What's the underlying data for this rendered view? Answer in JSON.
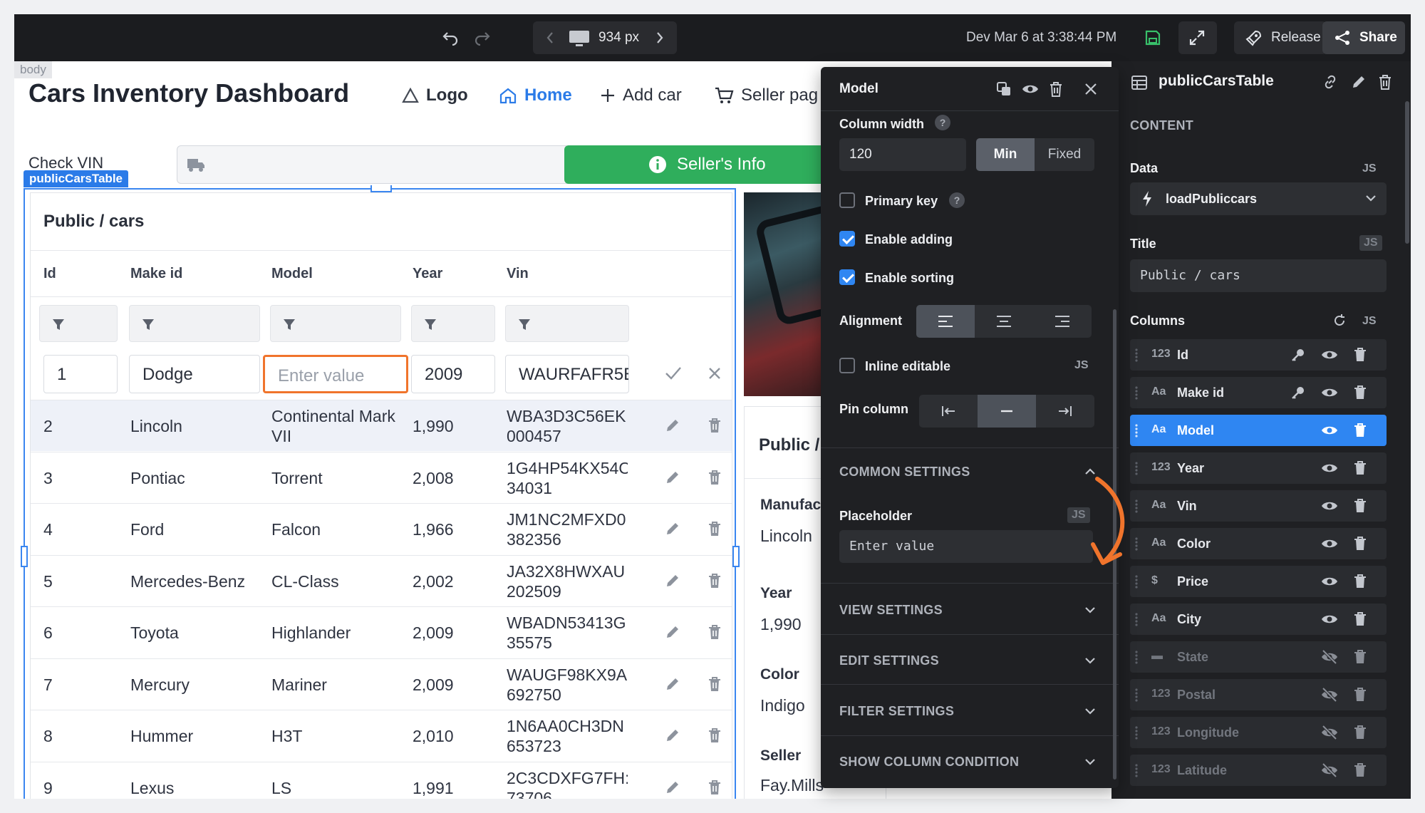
{
  "topbar": {
    "viewport": "934 px",
    "env_status": "Dev Mar 6 at 3:38:44 PM",
    "release_label": "Release",
    "share_label": "Share"
  },
  "canvas": {
    "body_tag": "body",
    "app_title": "Cars Inventory Dashboard",
    "nav": {
      "logo": "Logo",
      "home": "Home",
      "add_car": "Add car",
      "seller": "Seller pag"
    },
    "check_vin_label": "Check VIN",
    "sellers_button": "Seller's Info",
    "table_tag": "publicCarsTable"
  },
  "table": {
    "title": "Public / cars",
    "columns": [
      "Id",
      "Make id",
      "Model",
      "Year",
      "Vin"
    ],
    "edit_row": {
      "id": "1",
      "make": "Dodge",
      "model_placeholder": "Enter value",
      "year": "2009",
      "vin": "WAURFAFR5E"
    },
    "rows": [
      {
        "id": "2",
        "make": "Lincoln",
        "model": "Continental Mark VII",
        "year": "1,990",
        "vin": "WBA3D3C56EK 000457"
      },
      {
        "id": "3",
        "make": "Pontiac",
        "model": "Torrent",
        "year": "2,008",
        "vin": "1G4HP54KX54C 34031"
      },
      {
        "id": "4",
        "make": "Ford",
        "model": "Falcon",
        "year": "1,966",
        "vin": "JM1NC2MFXD0 382356"
      },
      {
        "id": "5",
        "make": "Mercedes-Benz",
        "model": "CL-Class",
        "year": "2,002",
        "vin": "JA32X8HWXAU 202509"
      },
      {
        "id": "6",
        "make": "Toyota",
        "model": "Highlander",
        "year": "2,009",
        "vin": "WBADN53413G 35575"
      },
      {
        "id": "7",
        "make": "Mercury",
        "model": "Mariner",
        "year": "2,009",
        "vin": "WAUGF98KX9A 692750"
      },
      {
        "id": "8",
        "make": "Hummer",
        "model": "H3T",
        "year": "2,010",
        "vin": "1N6AA0CH3DN 653723"
      },
      {
        "id": "9",
        "make": "Lexus",
        "model": "LS",
        "year": "1,991",
        "vin": "2C3CDXFG7FH: 73706"
      }
    ]
  },
  "detail": {
    "title": "Public /",
    "manufacturer_label": "Manufac",
    "manufacturer_value": "Lincoln",
    "year_label": "Year",
    "year_value": "1,990",
    "color_label": "Color",
    "color_value": "Indigo",
    "seller_label": "Seller",
    "seller_value": "Fay.Mills"
  },
  "model_panel": {
    "title": "Model",
    "column_width_label": "Column width",
    "column_width_value": "120",
    "width_mode_min": "Min",
    "width_mode_fixed": "Fixed",
    "primary_key_label": "Primary key",
    "primary_key_checked": false,
    "enable_adding_label": "Enable adding",
    "enable_adding_checked": true,
    "enable_sorting_label": "Enable sorting",
    "enable_sorting_checked": true,
    "alignment_label": "Alignment",
    "alignment_selected": "left",
    "inline_editable_label": "Inline editable",
    "inline_editable_checked": false,
    "pin_column_label": "Pin column",
    "pin_selected": "none",
    "js_label": "JS",
    "common_settings": "COMMON SETTINGS",
    "placeholder_label": "Placeholder",
    "placeholder_value": "Enter value",
    "view_settings": "VIEW SETTINGS",
    "edit_settings": "EDIT SETTINGS",
    "filter_settings": "FILTER SETTINGS",
    "show_column_condition": "SHOW COLUMN CONDITION"
  },
  "inspector": {
    "title": "publicCarsTable",
    "content_section": "CONTENT",
    "data_label": "Data",
    "data_value": "loadPubliccars",
    "title_label": "Title",
    "title_value": "Public / cars",
    "columns_label": "Columns",
    "js_label": "JS",
    "columns": [
      {
        "type": "123",
        "name": "Id",
        "key": true,
        "visible": true,
        "active": false
      },
      {
        "type": "Aa",
        "name": "Make id",
        "key": true,
        "visible": true,
        "active": false
      },
      {
        "type": "Aa",
        "name": "Model",
        "key": false,
        "visible": true,
        "active": true
      },
      {
        "type": "123",
        "name": "Year",
        "key": false,
        "visible": true,
        "active": false
      },
      {
        "type": "Aa",
        "name": "Vin",
        "key": false,
        "visible": true,
        "active": false
      },
      {
        "type": "Aa",
        "name": "Color",
        "key": false,
        "visible": true,
        "active": false
      },
      {
        "type": "$",
        "name": "Price",
        "key": false,
        "visible": true,
        "active": false
      },
      {
        "type": "Aa",
        "name": "City",
        "key": false,
        "visible": true,
        "active": false
      },
      {
        "type": "▬",
        "name": "State",
        "key": false,
        "visible": false,
        "active": false
      },
      {
        "type": "123",
        "name": "Postal",
        "key": false,
        "visible": false,
        "active": false
      },
      {
        "type": "123",
        "name": "Longitude",
        "key": false,
        "visible": false,
        "active": false
      },
      {
        "type": "123",
        "name": "Latitude",
        "key": false,
        "visible": false,
        "active": false
      }
    ]
  },
  "colors": {
    "accent": "#2f86f2",
    "success": "#2fae5c",
    "highlight": "#f0742c",
    "panel": "#1f2023"
  }
}
